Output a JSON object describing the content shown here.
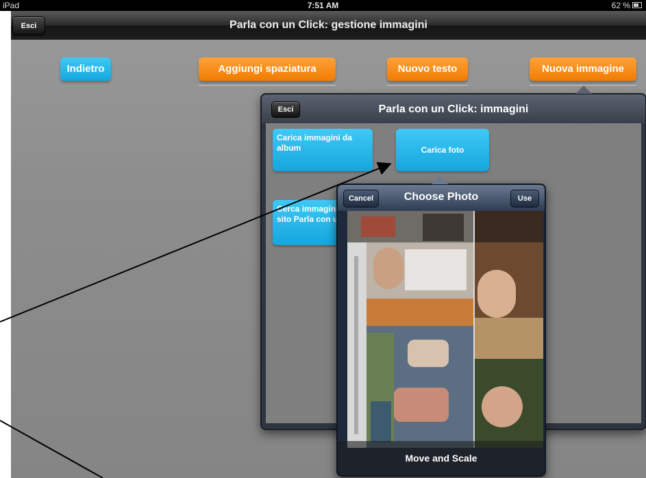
{
  "status": {
    "device": "iPad",
    "time": "7:51 AM",
    "battery": "62 %"
  },
  "navbar": {
    "exit": "Esci",
    "title": "Parla con un Click: gestione immagini"
  },
  "toolbar": {
    "back": "Indietro",
    "add_space": "Aggiungi spaziatura",
    "new_text": "Nuovo testo",
    "new_image": "Nuova immagine"
  },
  "images_popover": {
    "exit": "Esci",
    "title": "Parla con un Click: immagini",
    "load_album": "Carica immagini da album",
    "load_photo": "Carica foto",
    "search_site": "Cerca immagini sul sito Parla con un Click"
  },
  "photo_picker": {
    "cancel": "Cancel",
    "title": "Choose Photo",
    "use": "Use",
    "footer": "Move and Scale"
  },
  "colors": {
    "button_blue": "#15a6de",
    "button_orange": "#f07c00"
  }
}
